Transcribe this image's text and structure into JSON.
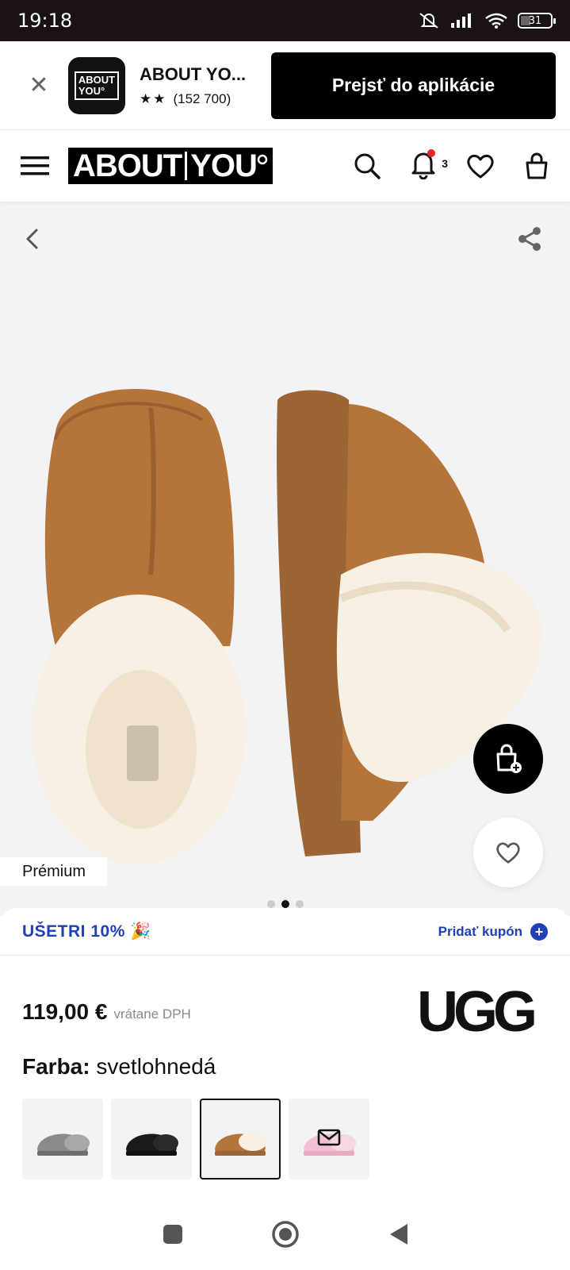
{
  "status_bar": {
    "time": "19:18",
    "battery": "31"
  },
  "app_banner": {
    "app_name": "ABOUT YO...",
    "rating_stars": "★★",
    "rating_count": "(152 700)",
    "logo_line1": "ABOUT",
    "logo_line2": "YOU°",
    "open_button_label": "Prejsť do aplikácie"
  },
  "header": {
    "logo_left": "ABOUT",
    "logo_right": "YOU",
    "notification_count": "3"
  },
  "gallery": {
    "badge": "Prémium",
    "dots": 3,
    "active_dot": 1
  },
  "coupon": {
    "text": "UŠETRI 10% 🎉",
    "add_label": "Pridať kupón"
  },
  "product": {
    "price": "119,00 €",
    "vat_note": "vrátane DPH",
    "brand": "UGG",
    "color_label": "Farba:",
    "color_value": "svetlohnedá"
  },
  "swatches": [
    {
      "name": "grey",
      "color": "#8a8a8c"
    },
    {
      "name": "black",
      "color": "#1a1a1a"
    },
    {
      "name": "chestnut",
      "color": "#b4743a",
      "selected": true
    },
    {
      "name": "pink",
      "color": "#f2bfd4"
    }
  ],
  "colors": {
    "accent": "#1f3fb8",
    "notification_dot": "#e3262e",
    "suede": "#b4743a",
    "fur": "#f7f0e4"
  }
}
